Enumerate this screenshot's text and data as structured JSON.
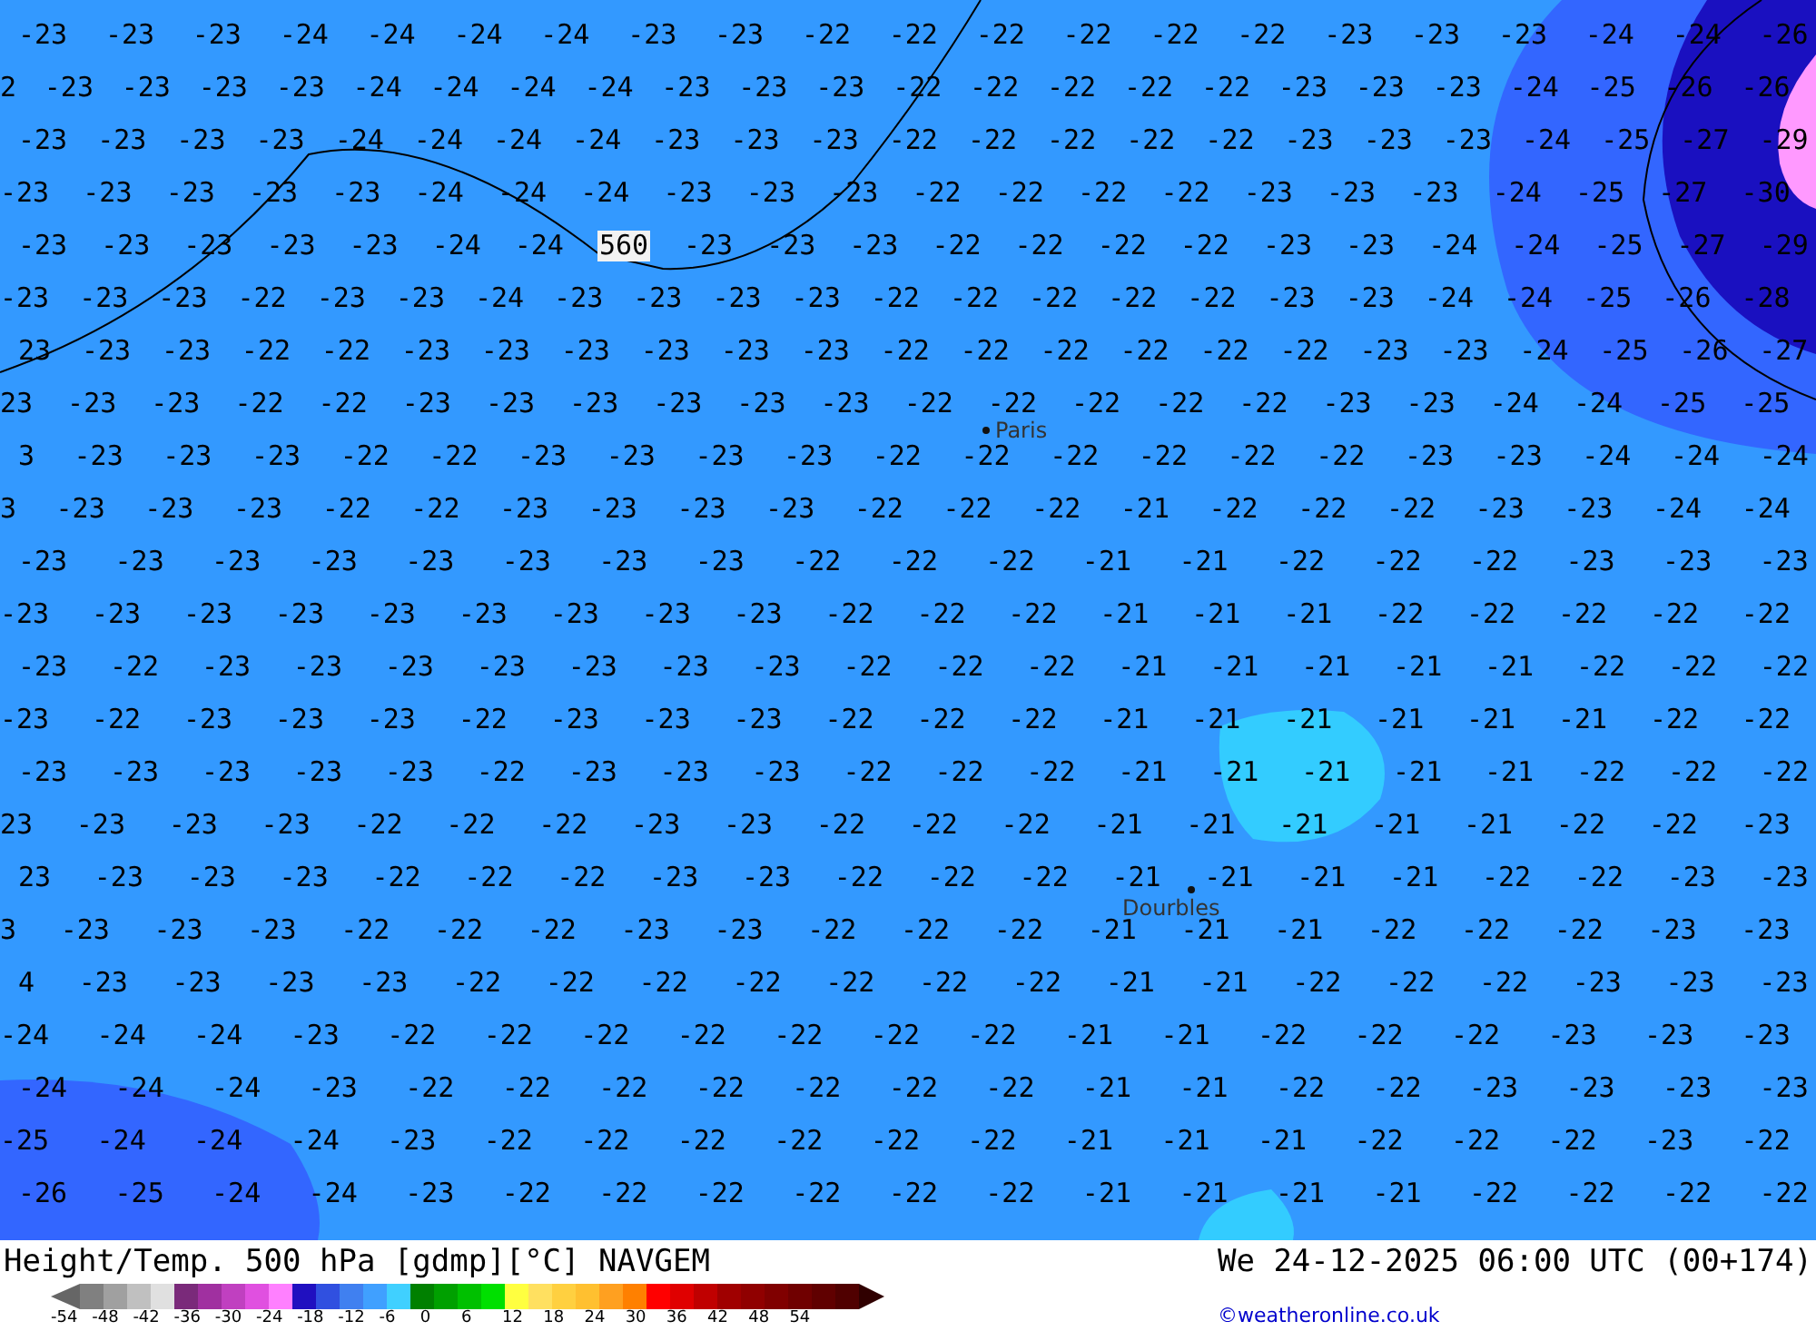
{
  "map": {
    "rows": [
      [
        "-23",
        "-23",
        "-23",
        "-24",
        "-24",
        "-24",
        "-24",
        "-23",
        "-23",
        "-22",
        "-22",
        "-22",
        "-22",
        "-22",
        "-22",
        "-23",
        "-23",
        "-23",
        "-24",
        "-24",
        "-26"
      ],
      [
        "2",
        "-23",
        "-23",
        "-23",
        "-23",
        "-24",
        "-24",
        "-24",
        "-24",
        "-23",
        "-23",
        "-23",
        "-22",
        "-22",
        "-22",
        "-22",
        "-22",
        "-23",
        "-23",
        "-23",
        "-24",
        "-25",
        "-26",
        "-26"
      ],
      [
        "-23",
        "-23",
        "-23",
        "-23",
        "-24",
        "-24",
        "-24",
        "-24",
        "-23",
        "-23",
        "-23",
        "-22",
        "-22",
        "-22",
        "-22",
        "-22",
        "-23",
        "-23",
        "-23",
        "-24",
        "-25",
        "-27",
        "-29"
      ],
      [
        "-23",
        "-23",
        "-23",
        "-23",
        "-23",
        "-24",
        "-24",
        "-24",
        "-23",
        "-23",
        "-23",
        "-22",
        "-22",
        "-22",
        "-22",
        "-23",
        "-23",
        "-23",
        "-24",
        "-25",
        "-27",
        "-30"
      ],
      [
        "-23",
        "-23",
        "-23",
        "-23",
        "-23",
        "-24",
        "-24",
        {
          "kind": "contour",
          "text": "560"
        },
        "-23",
        "-23",
        "-23",
        "-22",
        "-22",
        "-22",
        "-22",
        "-23",
        "-23",
        "-24",
        "-24",
        "-25",
        "-27",
        "-29"
      ],
      [
        "-23",
        "-23",
        "-23",
        "-22",
        "-23",
        "-23",
        "-24",
        "-23",
        "-23",
        "-23",
        "-23",
        "-22",
        "-22",
        "-22",
        "-22",
        "-22",
        "-23",
        "-23",
        "-24",
        "-24",
        "-25",
        "-26",
        "-28"
      ],
      [
        "23",
        "-23",
        "-23",
        "-22",
        "-22",
        "-23",
        "-23",
        "-23",
        "-23",
        "-23",
        "-23",
        "-22",
        "-22",
        "-22",
        "-22",
        "-22",
        "-22",
        "-23",
        "-23",
        "-24",
        "-25",
        "-26",
        "-27"
      ],
      [
        "23",
        "-23",
        "-23",
        "-22",
        "-22",
        "-23",
        "-23",
        "-23",
        "-23",
        "-23",
        "-23",
        "-22",
        "-22",
        "-22",
        "-22",
        "-22",
        "-23",
        "-23",
        "-24",
        "-24",
        "-25",
        "-25"
      ],
      [
        "3",
        "-23",
        "-23",
        "-23",
        "-22",
        "-22",
        "-23",
        "-23",
        "-23",
        "-23",
        "-22",
        "-22",
        "-22",
        "-22",
        "-22",
        "-22",
        "-23",
        "-23",
        "-24",
        "-24",
        "-24"
      ],
      [
        "3",
        "-23",
        "-23",
        "-23",
        "-22",
        "-22",
        "-23",
        "-23",
        "-23",
        "-23",
        "-22",
        "-22",
        "-22",
        "-21",
        "-22",
        "-22",
        "-22",
        "-23",
        "-23",
        "-24",
        "-24"
      ],
      [
        "-23",
        "-23",
        "-23",
        "-23",
        "-23",
        "-23",
        "-23",
        "-23",
        "-22",
        "-22",
        "-22",
        "-21",
        "-21",
        "-22",
        "-22",
        "-22",
        "-23",
        "-23",
        "-23"
      ],
      [
        "-23",
        "-23",
        "-23",
        "-23",
        "-23",
        "-23",
        "-23",
        "-23",
        "-23",
        "-22",
        "-22",
        "-22",
        "-21",
        "-21",
        "-21",
        "-22",
        "-22",
        "-22",
        "-22",
        "-22"
      ],
      [
        "-23",
        "-22",
        "-23",
        "-23",
        "-23",
        "-23",
        "-23",
        "-23",
        "-23",
        "-22",
        "-22",
        "-22",
        "-21",
        "-21",
        "-21",
        "-21",
        "-21",
        "-22",
        "-22",
        "-22"
      ],
      [
        "-23",
        "-22",
        "-23",
        "-23",
        "-23",
        "-22",
        "-23",
        "-23",
        "-23",
        "-22",
        "-22",
        "-22",
        "-21",
        "-21",
        "-21",
        "-21",
        "-21",
        "-21",
        "-22",
        "-22"
      ],
      [
        "-23",
        "-23",
        "-23",
        "-23",
        "-23",
        "-22",
        "-23",
        "-23",
        "-23",
        "-22",
        "-22",
        "-22",
        "-21",
        "-21",
        "-21",
        "-21",
        "-21",
        "-22",
        "-22",
        "-22"
      ],
      [
        "23",
        "-23",
        "-23",
        "-23",
        "-22",
        "-22",
        "-22",
        "-23",
        "-23",
        "-22",
        "-22",
        "-22",
        "-21",
        "-21",
        "-21",
        "-21",
        "-21",
        "-22",
        "-22",
        "-23"
      ],
      [
        "23",
        "-23",
        "-23",
        "-23",
        "-22",
        "-22",
        "-22",
        "-23",
        "-23",
        "-22",
        "-22",
        "-22",
        "-21",
        "-21",
        "-21",
        "-21",
        "-22",
        "-22",
        "-23",
        "-23"
      ],
      [
        "3",
        "-23",
        "-23",
        "-23",
        "-22",
        "-22",
        "-22",
        "-23",
        "-23",
        "-22",
        "-22",
        "-22",
        "-21",
        "-21",
        "-21",
        "-22",
        "-22",
        "-22",
        "-23",
        "-23"
      ],
      [
        "4",
        "-23",
        "-23",
        "-23",
        "-23",
        "-22",
        "-22",
        "-22",
        "-22",
        "-22",
        "-22",
        "-22",
        "-21",
        "-21",
        "-22",
        "-22",
        "-22",
        "-23",
        "-23",
        "-23"
      ],
      [
        "-24",
        "-24",
        "-24",
        "-23",
        "-22",
        "-22",
        "-22",
        "-22",
        "-22",
        "-22",
        "-22",
        "-21",
        "-21",
        "-22",
        "-22",
        "-22",
        "-23",
        "-23",
        "-23"
      ],
      [
        "-24",
        "-24",
        "-24",
        "-23",
        "-22",
        "-22",
        "-22",
        "-22",
        "-22",
        "-22",
        "-22",
        "-21",
        "-21",
        "-22",
        "-22",
        "-23",
        "-23",
        "-23",
        "-23"
      ],
      [
        "-25",
        "-24",
        "-24",
        "-24",
        "-23",
        "-22",
        "-22",
        "-22",
        "-22",
        "-22",
        "-22",
        "-21",
        "-21",
        "-21",
        "-22",
        "-22",
        "-22",
        "-23",
        "-22"
      ],
      [
        "-26",
        "-25",
        "-24",
        "-24",
        "-23",
        "-22",
        "-22",
        "-22",
        "-22",
        "-22",
        "-22",
        "-21",
        "-21",
        "-21",
        "-21",
        "-22",
        "-22",
        "-22",
        "-22"
      ]
    ],
    "cities": [
      {
        "name": "Paris"
      },
      {
        "name": "Dourbles"
      }
    ]
  },
  "footer": {
    "title": "Height/Temp. 500 hPa [gdmp][°C] NAVGEM",
    "valid_time": "We 24-12-2025 06:00 UTC (00+174)",
    "credit": "©weatheronline.co.uk",
    "legend": {
      "colors": [
        {
          "color": "#808080"
        },
        {
          "color": "#a0a0a0"
        },
        {
          "color": "#c0c0c0"
        },
        {
          "color": "#e0e0e0"
        },
        {
          "color": "#7a2a7a"
        },
        {
          "color": "#a030a0"
        },
        {
          "color": "#c040c0"
        },
        {
          "color": "#e050e0"
        },
        {
          "color": "#ff80ff"
        },
        {
          "color": "#2010c0"
        },
        {
          "color": "#3050e0"
        },
        {
          "color": "#4080f0"
        },
        {
          "color": "#40a0ff"
        },
        {
          "color": "#40d0ff"
        },
        {
          "color": "#008000"
        },
        {
          "color": "#00a000"
        },
        {
          "color": "#00c000"
        },
        {
          "color": "#00e000"
        },
        {
          "color": "#ffff40"
        },
        {
          "color": "#ffe060"
        },
        {
          "color": "#ffd040"
        },
        {
          "color": "#ffc030"
        },
        {
          "color": "#ffa020"
        },
        {
          "color": "#ff8000"
        },
        {
          "color": "#ff0000"
        },
        {
          "color": "#e00000"
        },
        {
          "color": "#c00000"
        },
        {
          "color": "#a00000"
        },
        {
          "color": "#900000"
        },
        {
          "color": "#800000"
        },
        {
          "color": "#700000"
        },
        {
          "color": "#600000"
        },
        {
          "color": "#500000"
        }
      ],
      "ticks": [
        "-54",
        "-48",
        "-42",
        "-36",
        "-30",
        "-24",
        "-18",
        "-12",
        "-6",
        "0",
        "6",
        "12",
        "18",
        "24",
        "30",
        "36",
        "42",
        "48",
        "54"
      ]
    }
  }
}
